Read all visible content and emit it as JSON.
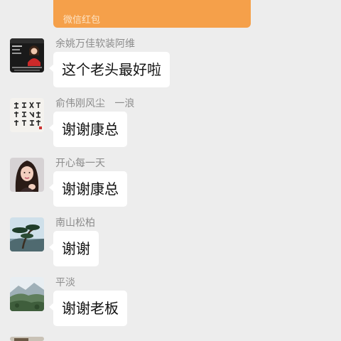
{
  "red_packet": {
    "label": "微信红包"
  },
  "messages": [
    {
      "sender": "余姚万佳软装阿维",
      "text": "这个老头最好啦",
      "avatar_icon": "woman-portrait-avatar"
    },
    {
      "sender": "俞伟刚风尘   一浪",
      "text": "谢谢康总",
      "avatar_icon": "calligraphy-avatar"
    },
    {
      "sender": "开心每一天",
      "text": "谢谢康总",
      "avatar_icon": "woman-selfie-avatar"
    },
    {
      "sender": "南山松柏",
      "text": "谢谢",
      "avatar_icon": "pine-tree-avatar"
    },
    {
      "sender": "平淡",
      "text": "谢谢老板",
      "avatar_icon": "mountain-landscape-avatar"
    }
  ],
  "colors": {
    "background": "#ededed",
    "bubble": "#ffffff",
    "red_packet": "#f5a04a",
    "sender_text": "#8c8c8c"
  }
}
